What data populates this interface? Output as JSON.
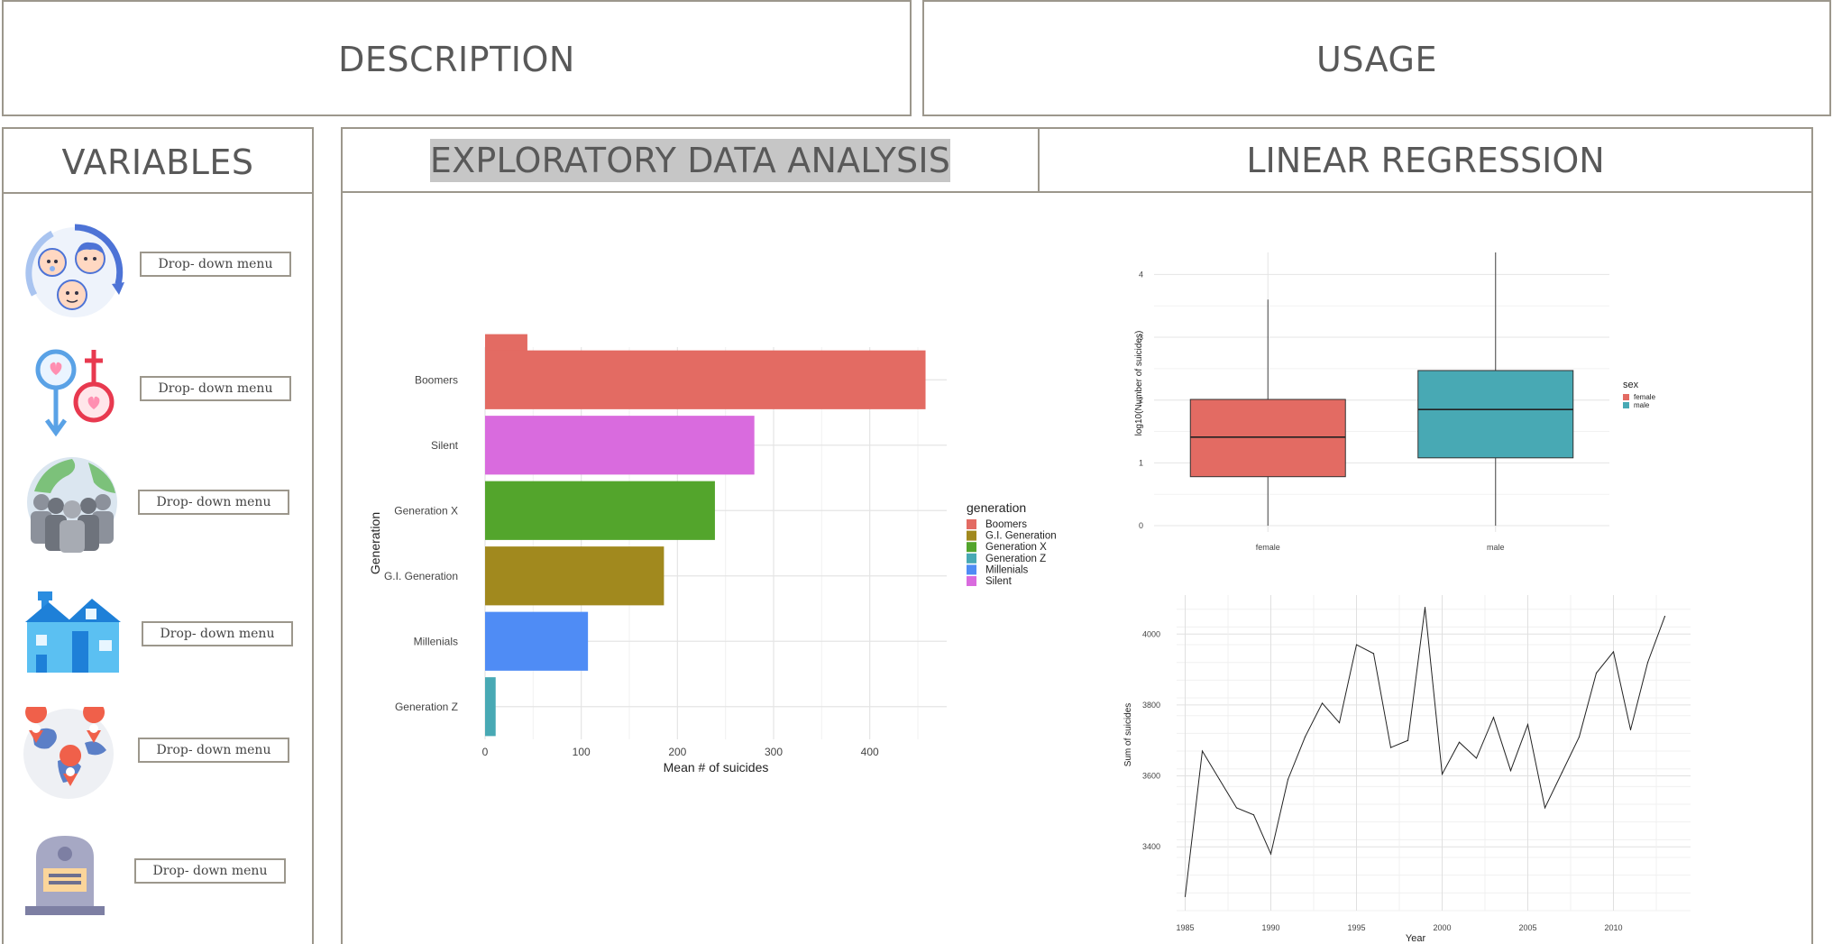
{
  "header": {
    "description_label": "DESCRIPTION",
    "usage_label": "USAGE"
  },
  "variables": {
    "title": "VARIABLES",
    "dropdowns": [
      {
        "icon": "generations-icon",
        "label": "Drop- down menu"
      },
      {
        "icon": "gender-icon",
        "label": "Drop- down menu"
      },
      {
        "icon": "population-icon",
        "label": "Drop- down menu"
      },
      {
        "icon": "house-icon",
        "label": "Drop- down menu"
      },
      {
        "icon": "globe-location-icon",
        "label": "Drop- down menu"
      },
      {
        "icon": "tombstone-icon",
        "label": "Drop- down menu"
      }
    ]
  },
  "tabs": {
    "eda_label": "EXPLORATORY DATA ANALYSIS",
    "lr_label": "LINEAR REGRESSION"
  },
  "colors": {
    "Boomers": "#e36b63",
    "G.I. Generation": "#a1891e",
    "Generation X": "#53a52c",
    "Generation Z": "#48a9b4",
    "Millenials": "#4f8cf5",
    "Silent": "#d96bde",
    "female": "#e36b63",
    "male": "#48a9b4"
  },
  "chart_data": [
    {
      "type": "bar",
      "orientation": "horizontal",
      "xlabel": "Mean # of suicides",
      "ylabel": "Generation",
      "categories": [
        "Boomers",
        "Silent",
        "Generation X",
        "G.I. Generation",
        "Millenials",
        "Generation Z"
      ],
      "values": [
        458,
        280,
        239,
        186,
        107,
        11
      ],
      "bar_extra": {
        "category": "Boomers",
        "value": 44
      },
      "xlim": [
        0,
        480
      ],
      "xticks": [
        0,
        100,
        200,
        300,
        400
      ],
      "legend": {
        "title": "generation",
        "entries": [
          "Boomers",
          "G.I. Generation",
          "Generation X",
          "Generation Z",
          "Millenials",
          "Silent"
        ]
      },
      "grid": true
    },
    {
      "type": "box",
      "xlabel": "",
      "ylabel": "log10(Number of suicides)",
      "categories": [
        "female",
        "male"
      ],
      "boxes": [
        {
          "name": "female",
          "min": 0,
          "q1": 0.78,
          "median": 1.41,
          "q3": 2.01,
          "max": 3.6
        },
        {
          "name": "male",
          "min": 0,
          "q1": 1.08,
          "median": 1.85,
          "q3": 2.47,
          "max": 4.35
        }
      ],
      "ylim": [
        -0.1,
        4.35
      ],
      "yticks": [
        0,
        1,
        2,
        3,
        4
      ],
      "legend": {
        "title": "sex",
        "entries": [
          "female",
          "male"
        ]
      },
      "grid": true
    },
    {
      "type": "line",
      "xlabel": "Year",
      "ylabel": "Sum of suicides",
      "x": [
        1985,
        1986,
        1987,
        1988,
        1989,
        1990,
        1991,
        1992,
        1993,
        1994,
        1995,
        1996,
        1997,
        1998,
        1999,
        2000,
        2001,
        2002,
        2003,
        2004,
        2005,
        2006,
        2007,
        2008,
        2009,
        2010,
        2011,
        2012,
        2013
      ],
      "y": [
        3260,
        3670,
        3590,
        3510,
        3490,
        3380,
        3590,
        3710,
        3805,
        3750,
        3970,
        3945,
        3680,
        3700,
        4075,
        3605,
        3695,
        3650,
        3765,
        3615,
        3745,
        3510,
        3610,
        3710,
        3890,
        3950,
        3730,
        3920,
        4050
      ],
      "xlim": [
        1984.5,
        2014.5
      ],
      "ylim": [
        3220,
        4110
      ],
      "xticks": [
        1985,
        1990,
        1995,
        2000,
        2005,
        2010
      ],
      "yticks": [
        3400,
        3600,
        3800,
        4000
      ],
      "grid": true
    }
  ]
}
